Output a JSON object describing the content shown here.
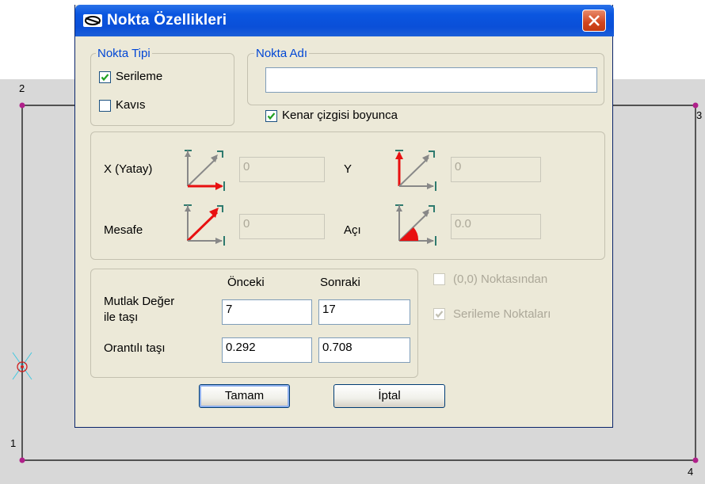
{
  "background": {
    "points": [
      {
        "id": "2",
        "label": "2"
      },
      {
        "id": "3",
        "label": "3"
      },
      {
        "id": "1",
        "label": "1"
      },
      {
        "id": "4",
        "label": "4"
      }
    ],
    "colors": {
      "point": "#b0208a",
      "fill": "#d8d8d8",
      "cursor": "#40c8e0",
      "line": "#000000"
    }
  },
  "dialog": {
    "title": "Nokta Özellikleri",
    "nokta_tipi": {
      "legend": "Nokta Tipi",
      "options": [
        {
          "label": "Serileme",
          "checked": true
        },
        {
          "label": "Kavıs",
          "checked": false
        }
      ]
    },
    "nokta_adi": {
      "legend": "Nokta Adı",
      "value": ""
    },
    "kenar": {
      "label": "Kenar çizgisi boyunca",
      "checked": true
    },
    "coords": {
      "x_label": "X (Yatay)",
      "x_value": "0",
      "y_label": "Y",
      "y_value": "0",
      "mesafe_label": "Mesafe",
      "mesafe_value": "0",
      "aci_label": "Açı",
      "aci_value": "0.0"
    },
    "move": {
      "col_prev": "Önceki",
      "col_next": "Sonraki",
      "row1_label_line1": "Mutlak Değer",
      "row1_label_line2": "ile taşı",
      "row1_prev": "7",
      "row1_next": "17",
      "row2_label": "Orantılı taşı",
      "row2_prev": "0.292",
      "row2_next": "0.708"
    },
    "options_right": [
      {
        "label": "(0,0) Noktasından",
        "checked": false
      },
      {
        "label": "Serileme Noktaları",
        "checked": true
      }
    ],
    "buttons": {
      "ok": "Tamam",
      "cancel": "İptal"
    }
  }
}
